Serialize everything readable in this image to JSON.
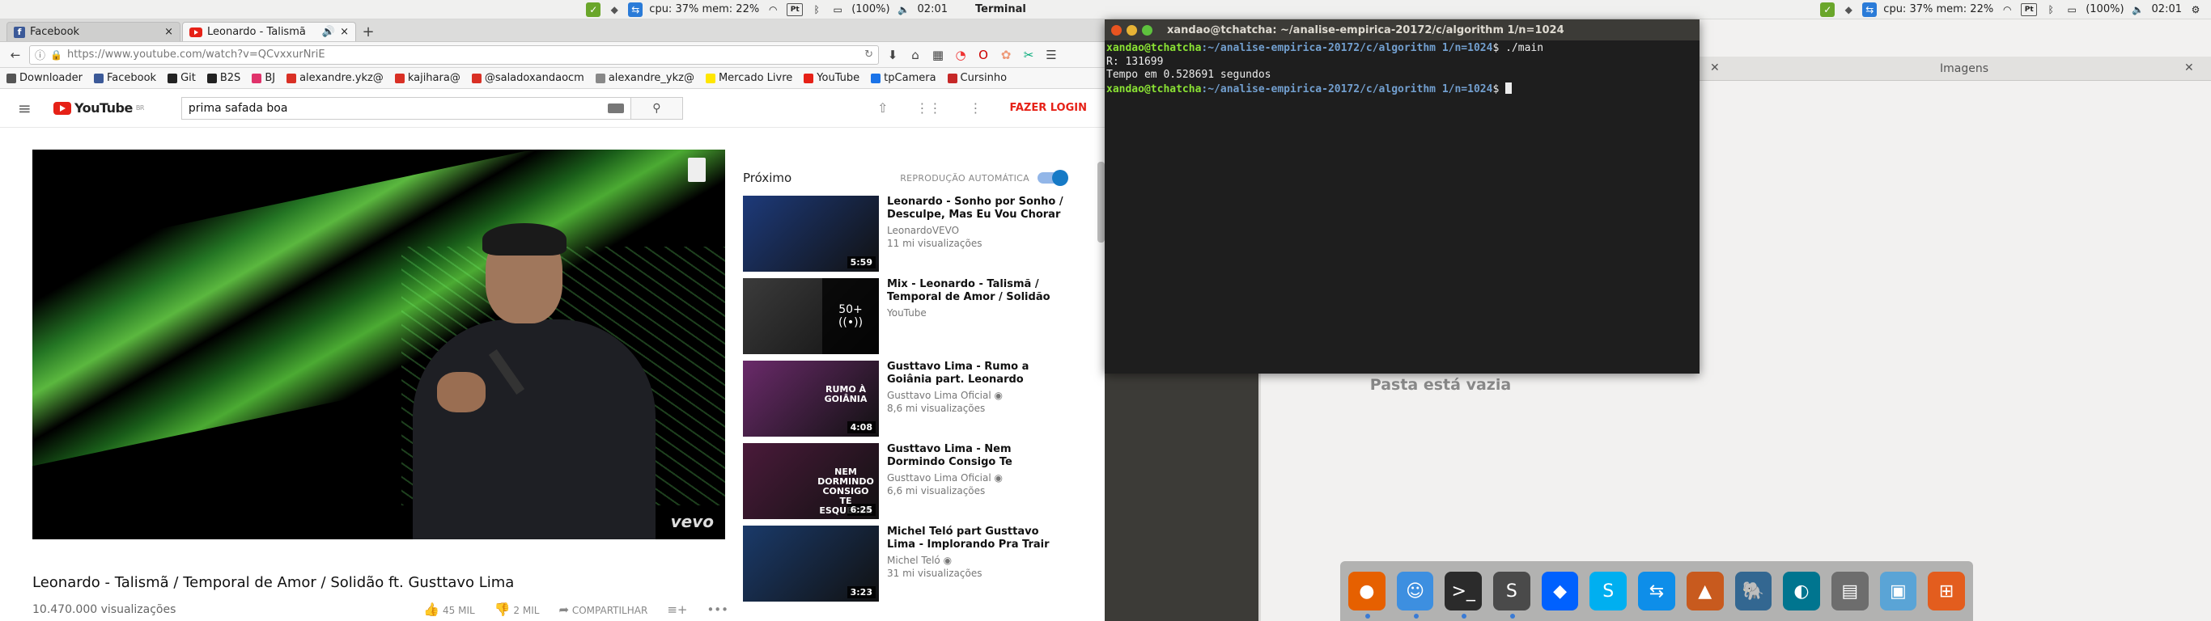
{
  "left_panel": {
    "cpu_mem": "cpu: 37% mem: 22%",
    "kbd": "Pt",
    "battery": "(100%)",
    "time": "02:01",
    "app_name": "Terminal"
  },
  "right_panel": {
    "cpu_mem": "cpu: 37% mem: 22%",
    "kbd": "Pt",
    "battery": "(100%)",
    "time": "02:01"
  },
  "browser": {
    "tabs": [
      {
        "title": "Facebook",
        "icon": "facebook-icon"
      },
      {
        "title": "Leonardo - Talismã",
        "icon": "youtube-icon"
      }
    ],
    "url": "https://www.youtube.com/watch?v=QCvxxurNriE",
    "bookmarks": [
      {
        "label": "Downloader",
        "icon": "gear-icon",
        "color": "#555555"
      },
      {
        "label": "Facebook",
        "icon": "facebook-icon",
        "color": "#3b5998"
      },
      {
        "label": "Git",
        "icon": "github-icon",
        "color": "#222222"
      },
      {
        "label": "B2S",
        "icon": "b2s-icon",
        "color": "#222222"
      },
      {
        "label": "BJ",
        "icon": "bj-icon",
        "color": "#e0336b"
      },
      {
        "label": "alexandre.ykz@",
        "icon": "gmail-icon",
        "color": "#d93025"
      },
      {
        "label": "kajihara@",
        "icon": "gmail-icon",
        "color": "#d93025"
      },
      {
        "label": "@saladoxandaocm",
        "icon": "gmail-icon",
        "color": "#d93025"
      },
      {
        "label": "alexandre_ykz@",
        "icon": "globe-icon",
        "color": "#888888"
      },
      {
        "label": "Mercado Livre",
        "icon": "mercadolivre-icon",
        "color": "#ffe600"
      },
      {
        "label": "YouTube",
        "icon": "youtube-icon",
        "color": "#e62117"
      },
      {
        "label": "tpCamera",
        "icon": "camera-icon",
        "color": "#1a73e8"
      },
      {
        "label": "Cursinho",
        "icon": "cursinho-icon",
        "color": "#c62828"
      }
    ]
  },
  "youtube": {
    "logo": "YouTube",
    "logo_sup": "BR",
    "search_value": "prima safada boa",
    "login": "FAZER LOGIN",
    "video_title": "Leonardo - Talismã / Temporal de Amor / Solidão ft. Gusttavo Lima",
    "views": "10.470.000 visualizações",
    "likes": "45 MIL",
    "dislikes": "2 MIL",
    "share": "COMPARTILHAR",
    "watermark": "vevo",
    "next_label": "Próximo",
    "autoplay_label": "REPRODUÇÃO AUTOMÁTICA",
    "related": [
      {
        "title": "Leonardo - Sonho por Sonho / Desculpe, Mas Eu Vou Chorar /",
        "channel": "LeonardoVEVO",
        "views": "11 mi visualizações",
        "duration": "5:59",
        "bg": "#1d3a7a"
      },
      {
        "title": "Mix - Leonardo - Talismã / Temporal de Amor / Solidão ft.",
        "channel": "YouTube",
        "views": "",
        "duration": "",
        "mix_count": "50+",
        "bg": "#3b3b3b"
      },
      {
        "title": "Gusttavo Lima - Rumo a Goiânia part. Leonardo (Buteco",
        "channel": "Gusttavo Lima Oficial ◉",
        "views": "8,6 mi visualizações",
        "duration": "4:08",
        "thumb_text": "RUMO À GOIÂNIA",
        "bg": "#6a2a6a"
      },
      {
        "title": "Gusttavo Lima - Nem Dormindo Consigo Te Esquecer part.",
        "channel": "Gusttavo Lima Oficial ◉",
        "views": "6,6 mi visualizações",
        "duration": "6:25",
        "thumb_text": "NEM DORMINDO CONSIGO TE ESQUECER",
        "bg": "#4a1a3a"
      },
      {
        "title": "Michel Teló part Gusttavo Lima - Implorando Pra Trair (CLIPE",
        "channel": "Michel Teló ◉",
        "views": "31 mi visualizações",
        "duration": "3:23",
        "bg": "#1a3a6a"
      }
    ]
  },
  "terminal": {
    "title": "xandao@tchatcha: ~/analise-empirica-20172/c/algorithm 1/n=1024",
    "prompt_user": "xandao@tchatcha",
    "prompt_path": ":~/analise-empirica-20172/c/algorithm 1/n=1024",
    "prompt_sign": "$",
    "command": " ./main",
    "output_1": "R: 131699",
    "output_2": "Tempo em 0.528691 segundos"
  },
  "file_manager": {
    "tab_label": "Imagens",
    "empty_text": "Pasta está vazia"
  },
  "dock": {
    "items": [
      {
        "name": "firefox-icon",
        "glyph": "●",
        "bg": "#e66000"
      },
      {
        "name": "finder-icon",
        "glyph": "☺",
        "bg": "#3d8fe0"
      },
      {
        "name": "terminal-icon",
        "glyph": ">_",
        "bg": "#2b2b2b"
      },
      {
        "name": "sublime-text-icon",
        "glyph": "S",
        "bg": "#4a4a4a"
      },
      {
        "name": "dropbox-icon",
        "glyph": "◆",
        "bg": "#0061fe"
      },
      {
        "name": "skype-icon",
        "glyph": "S",
        "bg": "#00aff0"
      },
      {
        "name": "teamviewer-icon",
        "glyph": "⇆",
        "bg": "#0e8ee9"
      },
      {
        "name": "matlab-icon",
        "glyph": "▲",
        "bg": "#c85a1e"
      },
      {
        "name": "postgresql-icon",
        "glyph": "🐘",
        "bg": "#336791"
      },
      {
        "name": "mysql-workbench-icon",
        "glyph": "◐",
        "bg": "#00758f"
      },
      {
        "name": "files-icon",
        "glyph": "▤",
        "bg": "#6d6d6d"
      },
      {
        "name": "virtualbox-icon",
        "glyph": "▣",
        "bg": "#5aa4d6"
      },
      {
        "name": "network-tool-icon",
        "glyph": "⊞",
        "bg": "#e35d1e"
      }
    ]
  }
}
